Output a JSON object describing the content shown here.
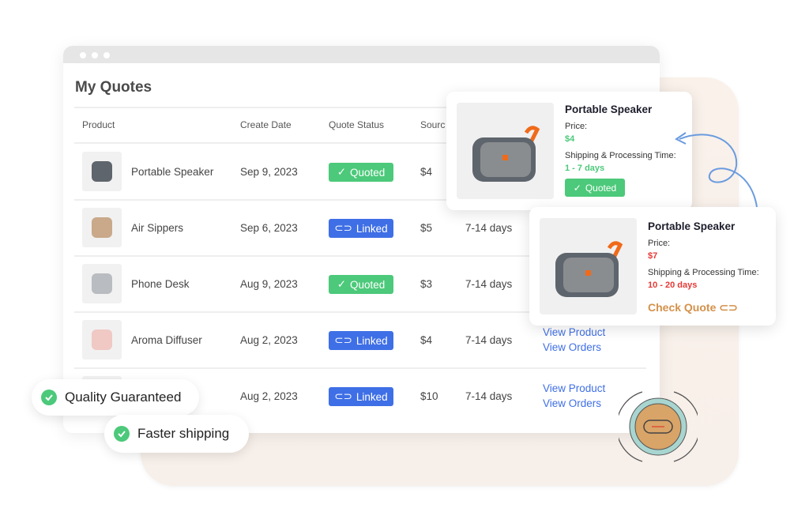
{
  "window": {
    "title": "My Quotes"
  },
  "table": {
    "headers": [
      "Product",
      "Create Date",
      "Quote Status",
      "Sourc"
    ],
    "rows": [
      {
        "product": "Portable Speaker",
        "date": "Sep 9, 2023",
        "status": "Quoted",
        "price": "$4",
        "time": "",
        "actions": []
      },
      {
        "product": "Air Sippers",
        "date": "Sep 6, 2023",
        "status": "Linked",
        "price": "$5",
        "time": "7-14 days",
        "actions": []
      },
      {
        "product": "Phone Desk",
        "date": "Aug 9, 2023",
        "status": "Quoted",
        "price": "$3",
        "time": "7-14 days",
        "actions": []
      },
      {
        "product": "Aroma Diffuser",
        "date": "Aug 2, 2023",
        "status": "Linked",
        "price": "$4",
        "time": "7-14 days",
        "actions": [
          "View Product",
          "View Orders"
        ]
      },
      {
        "product": "",
        "date": "Aug 2, 2023",
        "status": "Linked",
        "price": "$10",
        "time": "7-14 days",
        "actions": [
          "View Product",
          "View Orders"
        ]
      }
    ]
  },
  "card_quoted": {
    "title": "Portable Speaker",
    "price_label": "Price:",
    "price": "$4",
    "time_label": "Shipping & Processing Time:",
    "time": "1 - 7 days",
    "status": "Quoted"
  },
  "card_check": {
    "title": "Portable Speaker",
    "price_label": "Price:",
    "price": "$7",
    "time_label": "Shipping & Processing Time:",
    "time": "10 - 20 days",
    "action": "Check Quote"
  },
  "features": [
    "Quality Guaranteed",
    "Faster shipping"
  ],
  "colors": {
    "green": "#4cc97a",
    "blue": "#3f6fe6",
    "red": "#e53935",
    "orange": "#d4914a"
  }
}
